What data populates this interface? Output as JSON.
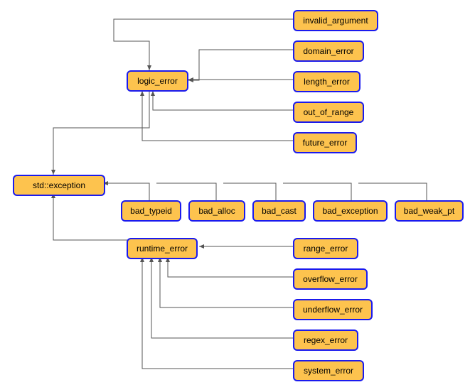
{
  "nodes": {
    "std_exception": "std::exception",
    "logic_error": "logic_error",
    "invalid_argument": "invalid_argument",
    "domain_error": "domain_error",
    "length_error": "length_error",
    "out_of_range": "out_of_range",
    "future_error": "future_error",
    "bad_typeid": "bad_typeid",
    "bad_alloc": "bad_alloc",
    "bad_cast": "bad_cast",
    "bad_exception": "bad_exception",
    "bad_weak_pt": "bad_weak_pt",
    "runtime_error": "runtime_error",
    "range_error": "range_error",
    "overflow_error": "overflow_error",
    "underflow_error": "underflow_error",
    "regex_error": "regex_error",
    "system_error": "system_error"
  }
}
